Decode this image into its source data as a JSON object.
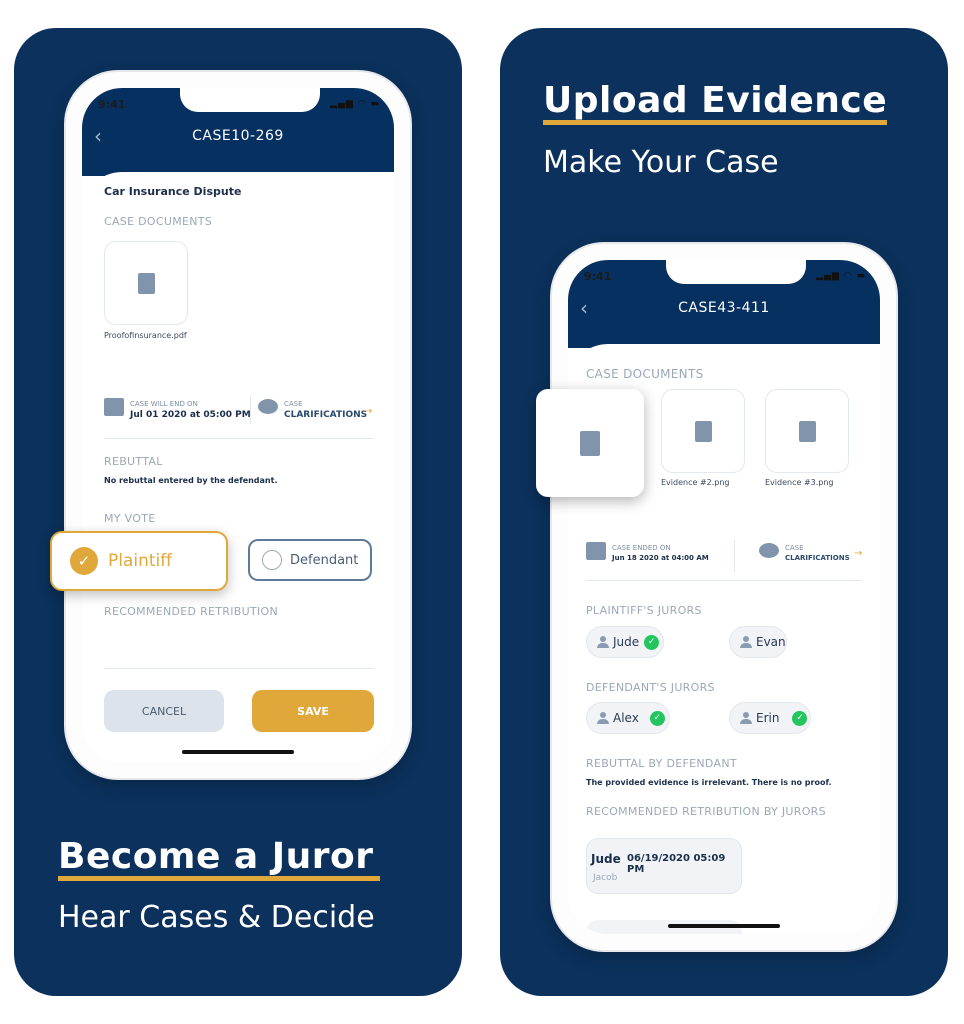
{
  "colors": {
    "navy": "#0b315c",
    "accent": "#e0a83a",
    "success": "#22c55e"
  },
  "left": {
    "headline": "Become a Juror",
    "subline": "Hear Cases & Decide",
    "status_time": "9:41",
    "case_title": "CASE10-269",
    "case_name": "Car Insurance Dispute",
    "docs_label": "CASE DOCUMENTS",
    "doc_name": "Proofofinsurance.pdf",
    "end_label": "CASE WILL END ON",
    "end_date": "Jul 01 2020 at 05:00 PM",
    "clar_top": "CASE",
    "clar_bottom": "CLARIFICATIONS",
    "rebuttal_label": "REBUTTAL",
    "rebuttal_text": "No rebuttal entered by the defendant.",
    "vote_label": "MY VOTE",
    "vote_options": [
      "Plaintiff",
      "Defendant"
    ],
    "vote_selected": "Plaintiff",
    "retribution_label": "RECOMMENDED RETRIBUTION",
    "cancel": "CANCEL",
    "save": "SAVE"
  },
  "right": {
    "headline": "Upload Evidence",
    "subline": "Make Your Case",
    "status_time": "9:41",
    "case_title": "CASE43-411",
    "docs_label": "CASE DOCUMENTS",
    "docs": [
      "Evidence #2.png",
      "Evidence #3.png"
    ],
    "end_label": "CASE ENDED ON",
    "end_date": "Jun 18 2020 at 04:00 AM",
    "clar_top": "CASE",
    "clar_bottom": "CLARIFICATIONS",
    "plaintiff_label": "PLAINTIFF'S JURORS",
    "plaintiff_jurors": [
      {
        "name": "Jude",
        "voted": true
      },
      {
        "name": "Evan",
        "voted": false
      }
    ],
    "defendant_label": "DEFENDANT'S JURORS",
    "defendant_jurors": [
      {
        "name": "Alex",
        "voted": true
      },
      {
        "name": "Erin",
        "voted": true
      }
    ],
    "rebuttal_label": "REBUTTAL BY DEFENDANT",
    "rebuttal_text": "The provided evidence is irrelevant. There is no proof.",
    "retribution_label": "RECOMMENDED RETRIBUTION BY JURORS",
    "retribution": {
      "author": "Jude",
      "date": "06/19/2020 05:09 PM",
      "text": "Jacob"
    }
  }
}
